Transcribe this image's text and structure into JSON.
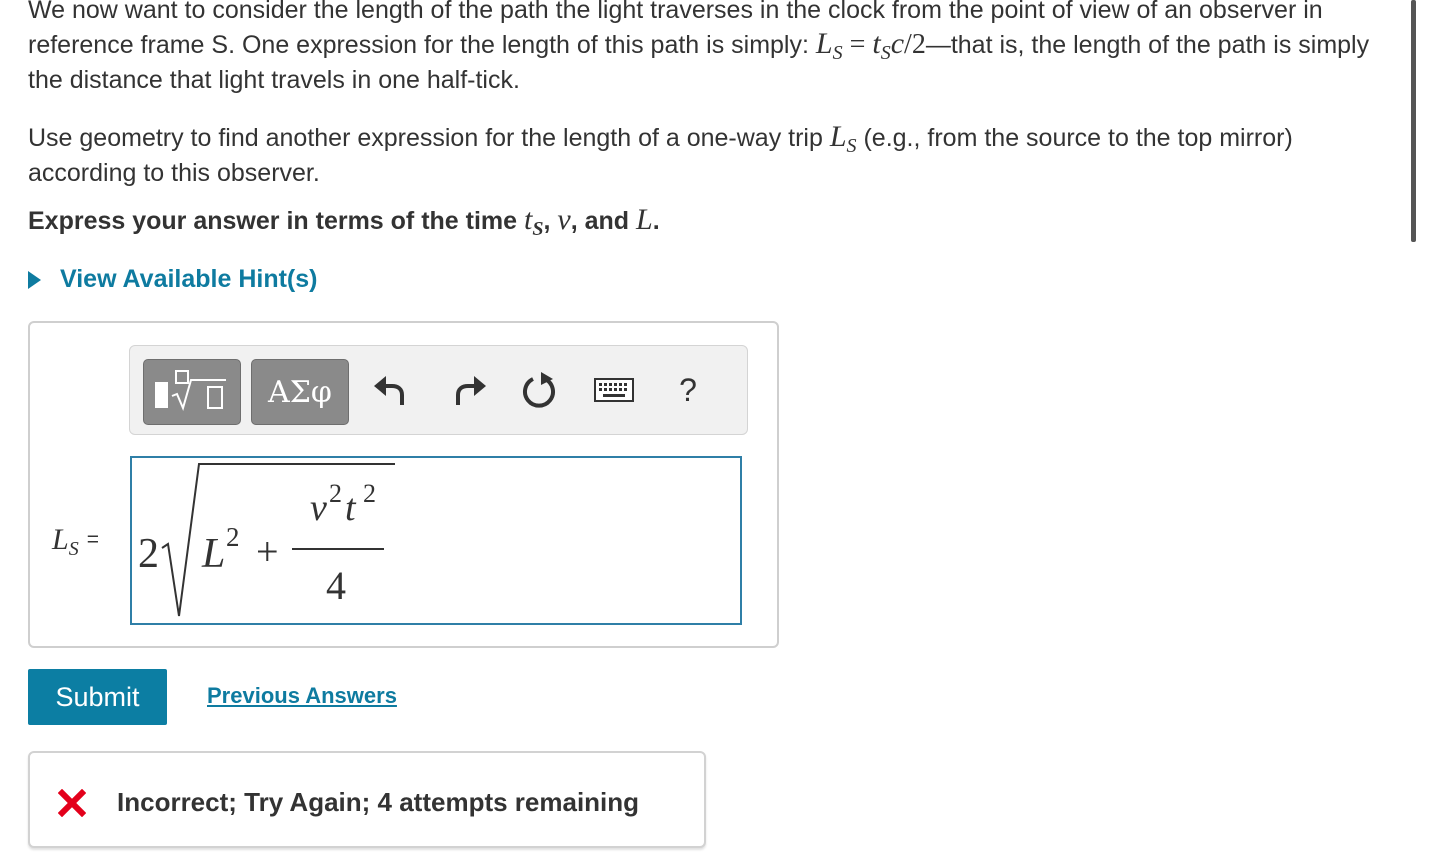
{
  "problem": {
    "p1_text_a": "We now want to consider the length of the path the light traverses in the clock from the point of view of an observer in reference frame S. One expression for the length of this path is simply: ",
    "p1_math_L": "L",
    "p1_math_Lsub": "S",
    "p1_math_eq": " = ",
    "p1_math_t": "t",
    "p1_math_tsub": "S",
    "p1_math_c": "c",
    "p1_math_div": "/2",
    "p1_text_b": "—that is, the length of the path is simply the distance that light travels in one half-tick.",
    "p2_text_a": "Use geometry to find another expression for the length of a one-way trip ",
    "p2_math_L": "L",
    "p2_math_Lsub": "S",
    "p2_text_b": " (e.g., from the source to the top mirror) according to this observer.",
    "prompt_a": "Express your answer in terms of the time ",
    "prompt_t": "t",
    "prompt_tsub": "S",
    "prompt_comma1": ", ",
    "prompt_v": "v",
    "prompt_and": ", and ",
    "prompt_L": "L",
    "prompt_end": "."
  },
  "hint": {
    "label": "View Available Hint(s)"
  },
  "toolbar": {
    "symbols_label": "ΑΣφ",
    "help_label": "?",
    "icons": [
      "templates-icon",
      "undo-icon",
      "redo-icon",
      "reset-icon",
      "keyboard-icon"
    ]
  },
  "answer": {
    "lhs_L": "L",
    "lhs_sub": "S",
    "lhs_eq": "=",
    "coef": "2",
    "L": "L",
    "L_exp": "2",
    "plus": "+",
    "v": "v",
    "v_exp": "2",
    "t": "t",
    "t_exp": "2",
    "den": "4"
  },
  "actions": {
    "submit_label": "Submit",
    "previous_answers_label": "Previous Answers"
  },
  "feedback": {
    "text": "Incorrect; Try Again; 4 attempts remaining",
    "status_color": "#e3001b"
  },
  "colors": {
    "accent": "#0c7ea3",
    "link": "#0e7ba0",
    "input_border": "#2f7fa7"
  }
}
